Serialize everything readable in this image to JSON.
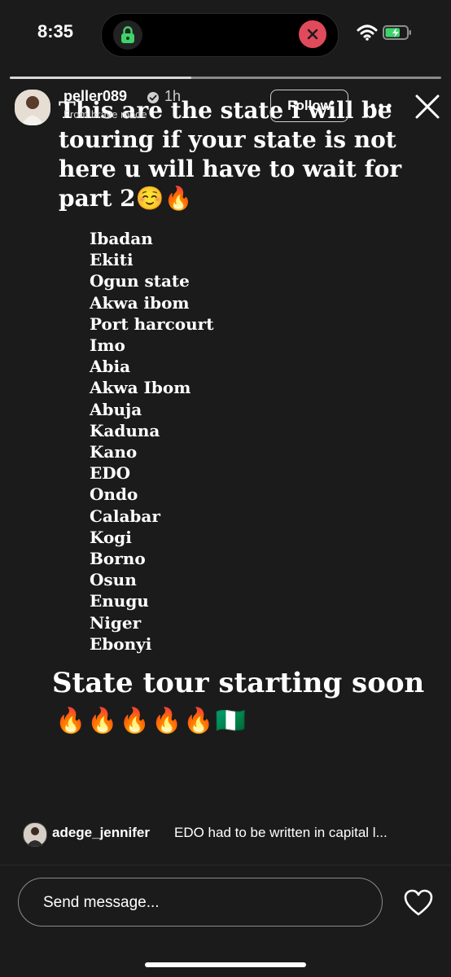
{
  "status_bar": {
    "time": "8:35",
    "battery_level": 0.7,
    "colors": {
      "vpn": "#3fd36b",
      "close": "#e14a5b",
      "battery": "#3fd36b"
    }
  },
  "story": {
    "progress": 0.42,
    "user": {
      "username": "peller089",
      "time": "1h",
      "subline": "From brave mode",
      "follow_label": "Follow"
    },
    "headline": "This are the state i will be touring if your state is not here u will have to wait for part 2☺️🔥",
    "states": [
      "Ibadan",
      "Ekiti",
      "Ogun state",
      "Akwa ibom",
      "Port harcourt",
      "Imo",
      "Abia",
      "Akwa Ibom",
      "Abuja",
      "Kaduna",
      "Kano",
      "EDO",
      "Ondo",
      "Calabar",
      "Kogi",
      "Borno",
      "Osun",
      "Enugu",
      "Niger",
      "Ebonyi"
    ],
    "tour_text": "State tour starting soon",
    "tour_emojis": "🔥🔥🔥🔥🔥🇳🇬"
  },
  "comment": {
    "username": "adege_jennifer",
    "text": "EDO had to be written in capital l..."
  },
  "footer": {
    "message_placeholder": "Send message..."
  }
}
